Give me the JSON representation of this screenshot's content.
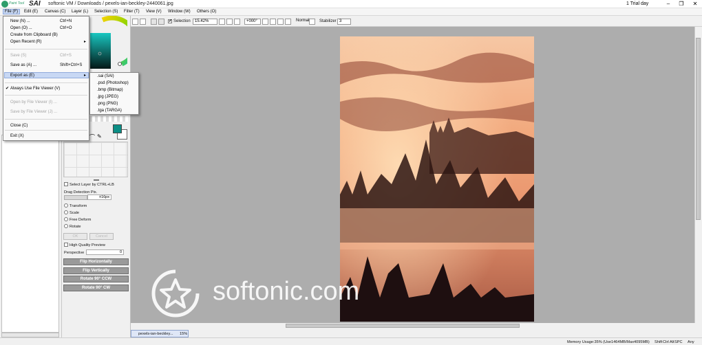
{
  "app": {
    "logo_text_small": "Paint Tool",
    "logo_text_big": "SAI",
    "document_path": "softonic VM / Downloads / pexels-ian-beckley-2440061.jpg",
    "trial_text": "1 Trial day"
  },
  "window_controls": {
    "minimize": "–",
    "maximize": "❐",
    "close": "✕"
  },
  "menubar": [
    "File (F)",
    "Edit (E)",
    "Canvas (C)",
    "Layer (L)",
    "Selection (S)",
    "Filter (T)",
    "View (V)",
    "Window (W)",
    "Others (O)"
  ],
  "file_menu": {
    "new": "New (N) ...",
    "new_sc": "Ctrl+N",
    "open": "Open (O) ...",
    "open_sc": "Ctrl+O",
    "clipboard": "Create from Clipboard (B)",
    "recent": "Open Recent (R)",
    "save": "Save (S)",
    "save_sc": "Ctrl+S",
    "save_as": "Save as (A) ...",
    "save_as_sc": "Shift+Ctrl+S",
    "export_as": "Export as (E)",
    "file_viewer": "Always Use File Viewer (V)",
    "open_viewer": "Open by File Viewer (I) ...",
    "save_viewer": "Save by File Viewer (J) ...",
    "close": "Close (C)",
    "exit": "Exit (X)"
  },
  "export_submenu": [
    ".sai (SAI)",
    ".psd (Photoshop)",
    ".bmp (Bitmap)",
    ".jpg (JPEG)",
    ".png (PNG)",
    ".tga (TARGA)"
  ],
  "toolbar": {
    "selection_label": "Selection",
    "zoom": "15.42%",
    "angle": "+000°",
    "blend": "Normal",
    "stabilizer_label": "Stabilizer",
    "stabilizer_value": "3"
  },
  "tool_panel": {
    "select_layer": "Select Layer by CTRL+LB",
    "drag_detection": "Drag Detection Pix.",
    "drag_value": "±16px",
    "transform": "Transform",
    "scale": "Scale",
    "free_deform": "Free Deform",
    "rotate": "Rotate",
    "ok": "OK",
    "cancel": "Cancel",
    "hq_preview": "High Quality Preview",
    "perspective": "Perspective",
    "perspective_value": "0",
    "flip_h": "Flip Horizontally",
    "flip_v": "Flip Vertically",
    "rot_ccw": "Rotate 90° CCW",
    "rot_cw": "Rotate 90° CW"
  },
  "colors": {
    "main_swatch": "#0b8e85",
    "secondary_swatch": "#ffffff",
    "canvas_bg": "#adadad"
  },
  "doc_tab": {
    "name": "pexels-ian-beckley...",
    "zoom": "15%"
  },
  "status": {
    "memory": "Memory Usage:35% (Use1464MB/Max4095MB)",
    "keys": [
      "Shift",
      "Ctrl",
      "Alt",
      "SPC",
      "Any"
    ]
  },
  "watermark": "softonic.com"
}
